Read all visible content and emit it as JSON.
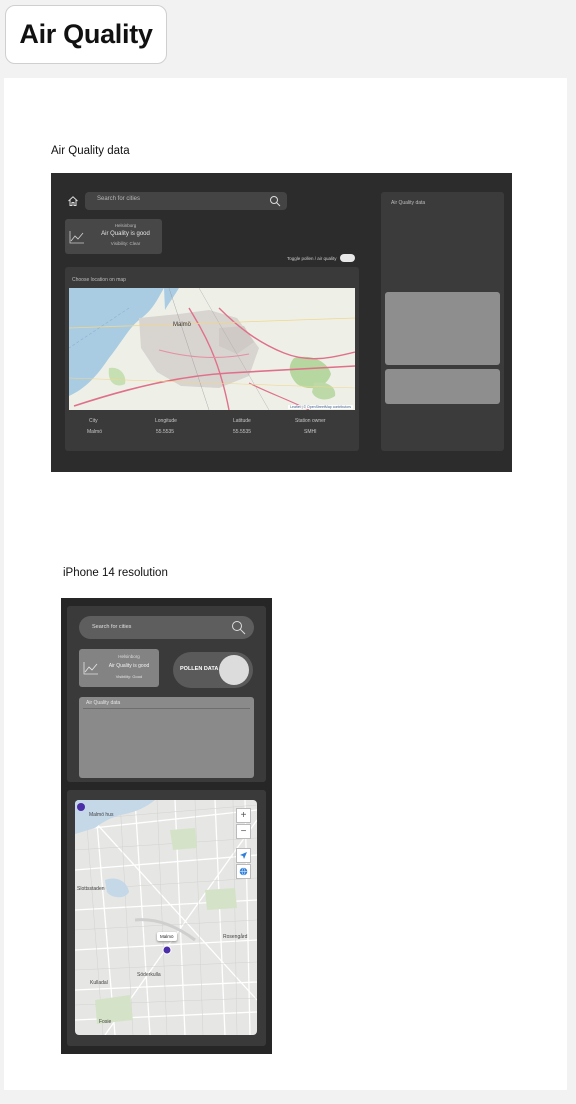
{
  "page": {
    "title": "Air Quality"
  },
  "labels": {
    "desktop": "Air Quality data",
    "mobile": "iPhone 14 resolution"
  },
  "desktop": {
    "search_placeholder": "Search for cities",
    "aq_card": {
      "city": "Helsinborg",
      "status": "Air Quality is good",
      "sub": "Visibility: Clear"
    },
    "toggle_label": "Toggle pollen / air quality",
    "map_card": {
      "title": "Choose location on map",
      "map_city": "Malmö",
      "attribution": "Leaflet | © OpenStreetMap contributors",
      "columns": [
        "City",
        "Longitude",
        "Latitude",
        "Station owner"
      ],
      "values": [
        "Malmö",
        "55.5535",
        "55.5535",
        "SMHI"
      ]
    },
    "side_panel_title": "Air Quality data"
  },
  "mobile": {
    "search_placeholder": "Search for cities",
    "aq_card": {
      "city": "Helsinborg",
      "status": "Air Quality is good",
      "sub": "Visibility: Good"
    },
    "pollen_label": "POLLEN DATA",
    "aq_panel_title": "Air Quality data",
    "map": {
      "popup": "Malmö",
      "places": [
        "Malmö hus",
        "Slottsstaden",
        "Söderkulla",
        "Kulladal",
        "Rosengård",
        "Fosie"
      ],
      "zoom_in": "+",
      "zoom_out": "−"
    }
  },
  "colors": {
    "frame": "#2c2c2c",
    "panel": "#3a3a3a",
    "pin": "#4b2fa8"
  }
}
